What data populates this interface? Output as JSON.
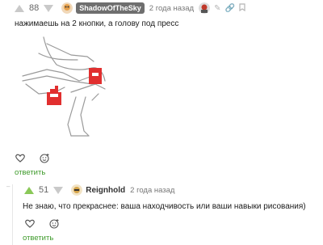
{
  "comment1": {
    "score": "88",
    "username": "ShadowOfTheSky",
    "time": "2 года назад",
    "text": "нажимаешь на 2 кнопки, а голову под пресс",
    "reply_label": "ответить"
  },
  "comment2": {
    "score": "51",
    "username": "Reignhold",
    "time": "2 года назад",
    "text": "Не знаю, что прекраснее: ваша находчивость или ваши навыки рисования)",
    "reply_label": "ответить"
  },
  "icons": {
    "like": "heart-icon",
    "emoji": "emoji-add-icon",
    "edit": "pencil-icon",
    "link": "link-icon",
    "bookmark": "bookmark-icon"
  },
  "colors": {
    "accent_green": "#3d9a2a",
    "vote_green": "#8ac858",
    "user_tag_bg": "#6f6f6f",
    "button_red": "#e12f2f"
  }
}
